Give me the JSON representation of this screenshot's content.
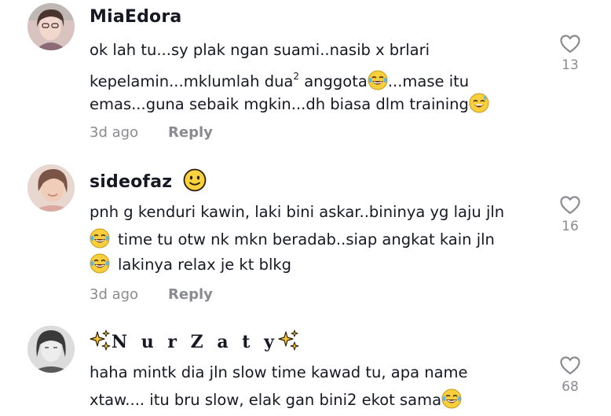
{
  "comments": [
    {
      "username": "MiaEdora",
      "line1": "ok lah tu...sy plak ngan suami..nasib x brlari",
      "line2_a": "kepelamin...mklumlah dua",
      "line2_sup": "2",
      "line2_b": " anggota",
      "line2_c": "...mase itu",
      "line3": "emas...guna sebaik mgkin...dh biasa dlm training",
      "time": "3d ago",
      "reply": "Reply",
      "likes": "13",
      "emojis": [
        "joy-emoji",
        "sweat-smile-emoji"
      ]
    },
    {
      "username": "sideofaz",
      "username_emoji": "slightly-smiling-emoji",
      "line1": "pnh g kenduri kawin, laki bini askar..bininya yg laju jln",
      "line2": "time tu otw nk mkn beradab..siap angkat kain jln",
      "line3": "lakinya relax je kt blkg",
      "time": "3d ago",
      "reply": "Reply",
      "likes": "16"
    },
    {
      "username": "N u r Z a t y",
      "line1": "haha mintk dia jln slow time kawad tu, apa name",
      "line2": "xtaw.... itu bru slow, elak gan bini2 ekot sama",
      "likes": "68"
    }
  ],
  "colors": {
    "text": "#161823",
    "muted": "#8a8b91",
    "emoji": "#f7c948"
  }
}
